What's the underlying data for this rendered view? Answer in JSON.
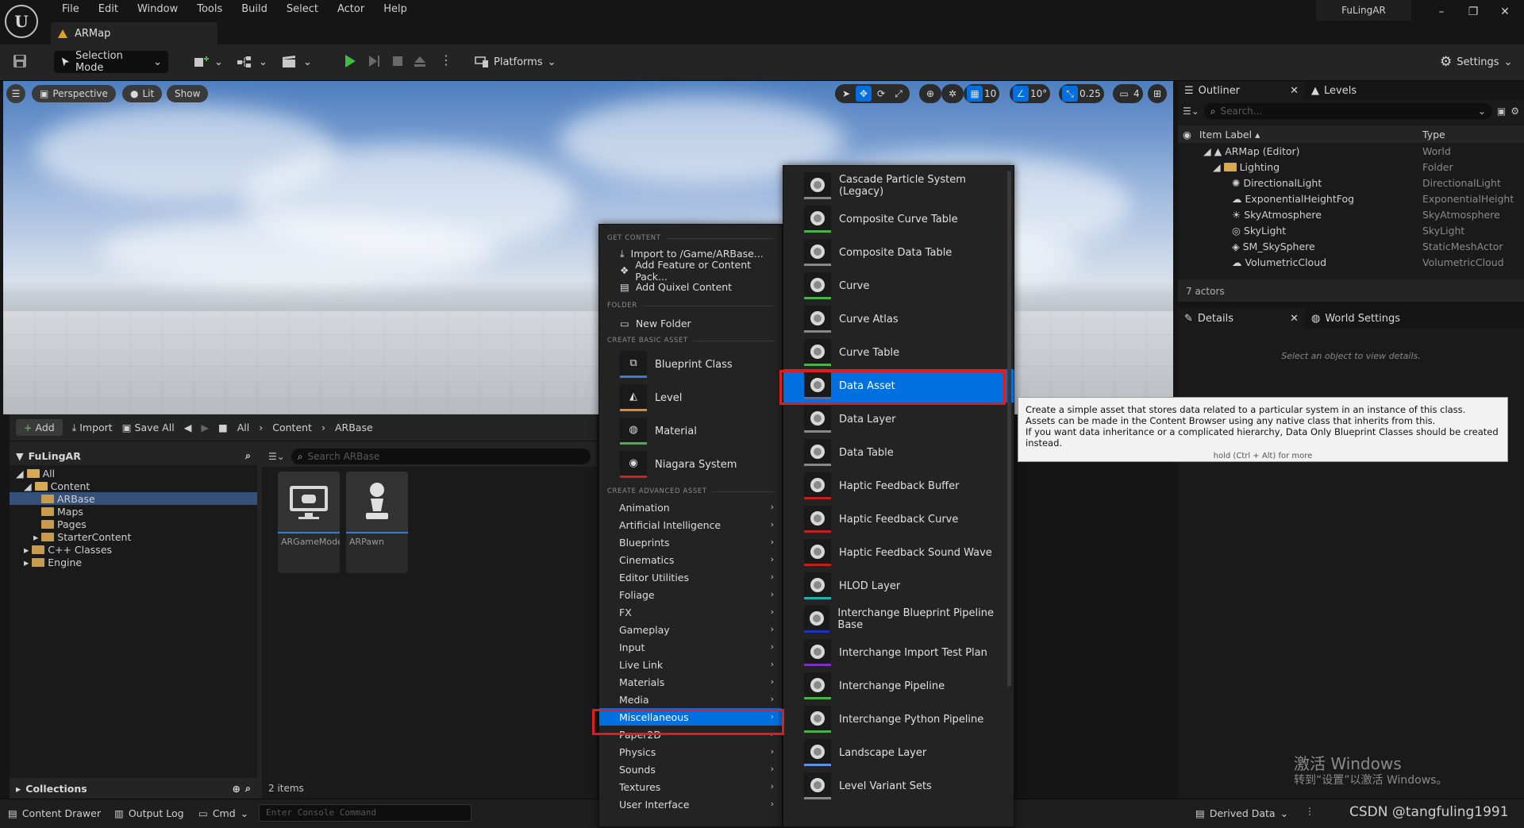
{
  "window": {
    "project_name": "FuLingAR",
    "document_tab": "ARMap"
  },
  "menubar": [
    "File",
    "Edit",
    "Window",
    "Tools",
    "Build",
    "Select",
    "Actor",
    "Help"
  ],
  "toolbar": {
    "selection_mode": "Selection Mode",
    "platforms": "Platforms",
    "settings": "Settings"
  },
  "viewport": {
    "perspective": "Perspective",
    "lit": "Lit",
    "show": "Show",
    "grid_snap": "10",
    "rotation_snap": "10°",
    "scale_snap": "0.25",
    "camera_speed": "4"
  },
  "outliner": {
    "tab_outliner": "Outliner",
    "tab_levels": "Levels",
    "search_placeholder": "Search...",
    "col_label": "Item Label",
    "col_type": "Type",
    "rows": [
      {
        "label": "ARMap (Editor)",
        "type": "World"
      },
      {
        "label": "Lighting",
        "type": "Folder"
      },
      {
        "label": "DirectionalLight",
        "type": "DirectionalLight"
      },
      {
        "label": "ExponentialHeightFog",
        "type": "ExponentialHeight"
      },
      {
        "label": "SkyAtmosphere",
        "type": "SkyAtmosphere"
      },
      {
        "label": "SkyLight",
        "type": "SkyLight"
      },
      {
        "label": "SM_SkySphere",
        "type": "StaticMeshActor"
      },
      {
        "label": "VolumetricCloud",
        "type": "VolumetricCloud"
      }
    ],
    "count": "7 actors"
  },
  "details": {
    "tab_details": "Details",
    "tab_world": "World Settings",
    "empty": "Select an object to view details."
  },
  "content_browser": {
    "add": "Add",
    "import": "Import",
    "save_all": "Save All",
    "path": [
      "All",
      "Content",
      "ARBase"
    ],
    "tree_root": "FuLingAR",
    "tree": [
      "All",
      "Content",
      "ARBase",
      "Maps",
      "Pages",
      "StarterContent",
      "C++ Classes",
      "Engine"
    ],
    "search_placeholder": "Search ARBase",
    "assets": [
      "ARGameMode",
      "ARPawn"
    ],
    "item_count": "2 items",
    "collections": "Collections"
  },
  "context_menu": {
    "sec_get": "GET CONTENT",
    "get": [
      "Import to /Game/ARBase...",
      "Add Feature or Content Pack...",
      "Add Quixel Content"
    ],
    "sec_folder": "FOLDER",
    "folder": "New Folder",
    "sec_basic": "CREATE BASIC ASSET",
    "basic": [
      {
        "label": "Blueprint Class",
        "color": "#3a7bd5"
      },
      {
        "label": "Level",
        "color": "#e08a2a"
      },
      {
        "label": "Material",
        "color": "#4ab04a"
      },
      {
        "label": "Niagara System",
        "color": "#d02020"
      }
    ],
    "sec_adv": "CREATE ADVANCED ASSET",
    "categories": [
      "Animation",
      "Artificial Intelligence",
      "Blueprints",
      "Cinematics",
      "Editor Utilities",
      "Foliage",
      "FX",
      "Gameplay",
      "Input",
      "Live Link",
      "Materials",
      "Media",
      "Miscellaneous",
      "Paper2D",
      "Physics",
      "Sounds",
      "Textures",
      "User Interface"
    ],
    "selected_category": "Miscellaneous"
  },
  "submenu": {
    "items": [
      {
        "label": "Cascade Particle System (Legacy)",
        "color": "#888888"
      },
      {
        "label": "Composite Curve Table",
        "color": "#4ab04a"
      },
      {
        "label": "Composite Data Table",
        "color": "#888888"
      },
      {
        "label": "Curve",
        "color": "#4ab04a"
      },
      {
        "label": "Curve Atlas",
        "color": "#888888"
      },
      {
        "label": "Curve Table",
        "color": "#4ab04a"
      },
      {
        "label": "Data Asset",
        "color": "#5a6a9a"
      },
      {
        "label": "Data Layer",
        "color": "#888888"
      },
      {
        "label": "Data Table",
        "color": "#888888"
      },
      {
        "label": "Haptic Feedback Buffer",
        "color": "#c02020"
      },
      {
        "label": "Haptic Feedback Curve",
        "color": "#c02020"
      },
      {
        "label": "Haptic Feedback Sound Wave",
        "color": "#c02020"
      },
      {
        "label": "HLOD Layer",
        "color": "#20b0b0"
      },
      {
        "label": "Interchange Blueprint Pipeline Base",
        "color": "#2030c0"
      },
      {
        "label": "Interchange Import Test Plan",
        "color": "#8030c0"
      },
      {
        "label": "Interchange Pipeline",
        "color": "#4ab04a"
      },
      {
        "label": "Interchange Python Pipeline",
        "color": "#4ab04a"
      },
      {
        "label": "Landscape Layer",
        "color": "#6090e0"
      },
      {
        "label": "Level Variant Sets",
        "color": "#888888"
      }
    ],
    "selected": "Data Asset"
  },
  "tooltip": {
    "line1": "Create a simple asset that stores data related to a particular system in an instance of this class.",
    "line2": "Assets can be made in the Content Browser using any native class that inherits from this.",
    "line3": "If you want data inheritance or a complicated hierarchy, Data Only Blueprint Classes should be created instead.",
    "hint": "hold (Ctrl + Alt) for more"
  },
  "statusbar": {
    "content_drawer": "Content Drawer",
    "output_log": "Output Log",
    "cmd": "Cmd",
    "console_placeholder": "Enter Console Command",
    "derived_data": "Derived Data"
  },
  "watermark": {
    "activate": "激活 Windows",
    "activate_sub": "转到“设置”以激活 Windows。",
    "csdn": "CSDN @tangfuling1991"
  }
}
